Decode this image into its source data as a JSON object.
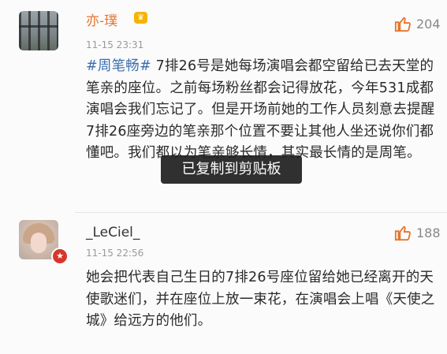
{
  "comments": [
    {
      "username": "亦-璞",
      "time": "11-15 23:31",
      "likes": "204",
      "hashtag": "#周笔畅#",
      "text": " 7排26号是她每场演唱会都空留给已去天堂的笔亲的座位。之前每场粉丝都会记得放花，今年531成都演唱会我们忘记了。但是开场前她的工作人员刻意去提醒7排26座旁边的笔亲那个位置不要让其他人坐还说你们都懂吧。我们都以为笔亲够长情，其实最长情的是周笔。"
    },
    {
      "username": "_LeCiel_",
      "time": "11-15 22:56",
      "likes": "188",
      "text": "她会把代表自己生日的7排26号座位留给她已经离开的天使歌迷们，并在座位上放一束花，在演唱会上唱《天使之城》给远方的他们。"
    }
  ],
  "toast": "已复制到剪贴板",
  "icons": {
    "like": "thumbs-up-icon",
    "crown": "crown-icon",
    "verified": "verified-badge-icon"
  },
  "colors": {
    "username_vip": "#e8742a",
    "hashtag": "#3a6fb0",
    "like_icon": "#e8742a"
  }
}
